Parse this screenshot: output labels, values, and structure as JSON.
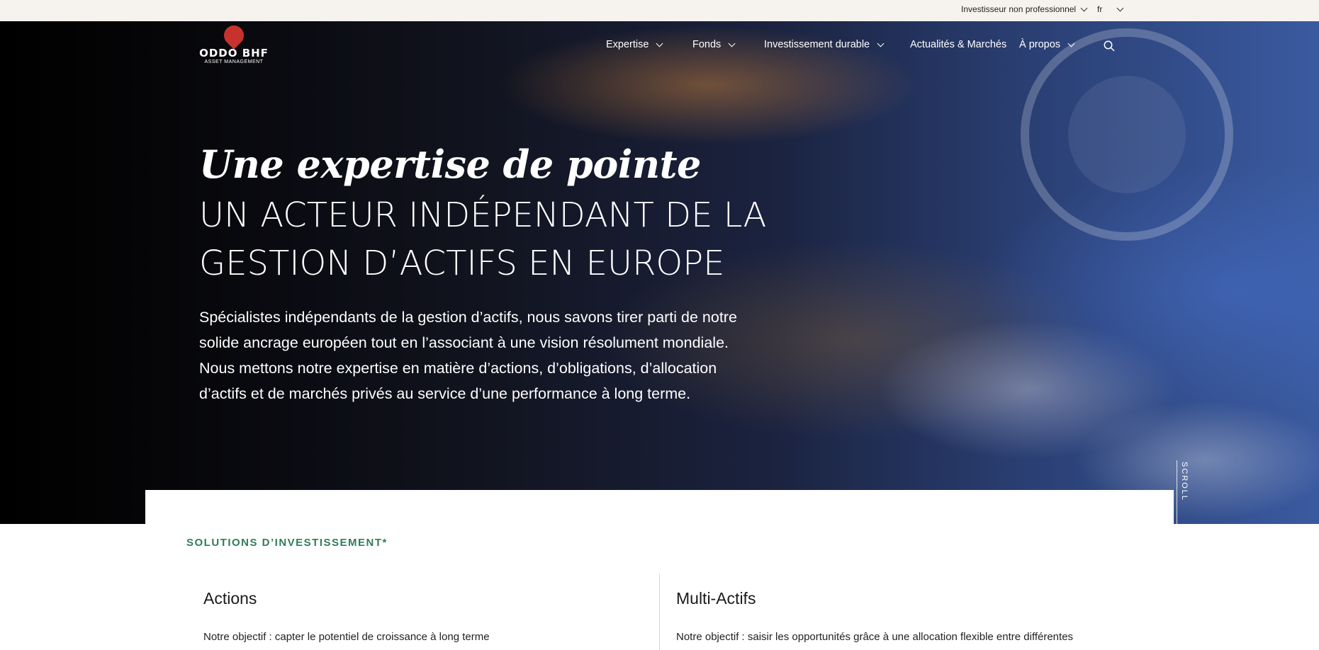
{
  "topbar": {
    "investor_label": "Investisseur non professionnel",
    "language_label": "fr"
  },
  "logo": {
    "name": "ODDO BHF",
    "subtitle": "ASSET MANAGEMENT",
    "brand_color": "#c8322d"
  },
  "nav": {
    "items": [
      {
        "label": "Expertise",
        "has_dropdown": true
      },
      {
        "label": "Fonds",
        "has_dropdown": true
      },
      {
        "label": "Investissement durable",
        "has_dropdown": true
      },
      {
        "label": "Actualités & Marchés",
        "has_dropdown": false
      },
      {
        "label": "À propos",
        "has_dropdown": true
      }
    ],
    "search_icon": "search-icon"
  },
  "hero": {
    "tagline": "Une expertise de pointe",
    "title_line1": "UN ACTEUR INDÉPENDANT DE LA",
    "title_line2": "GESTION D’ACTIFS EN EUROPE",
    "description": "Spécialistes indépendants de la gestion d’actifs, nous savons tirer parti de notre solide ancrage européen tout en l’associant à une vision résolument mondiale. Nous mettons notre expertise en matière d’actions, d’obligations, d’allocation d’actifs et de marchés privés au service d’une performance à long terme.",
    "scroll_label": "SCROLL"
  },
  "solutions": {
    "kicker": "SOLUTIONS D’INVESTISSEMENT*",
    "kicker_color": "#2f7d57",
    "columns": [
      {
        "title": "Actions",
        "text": "Notre objectif : capter le potentiel de croissance à long terme"
      },
      {
        "title": "Multi-Actifs",
        "text": "Notre objectif : saisir les opportunités grâce à une allocation flexible entre différentes"
      }
    ]
  }
}
